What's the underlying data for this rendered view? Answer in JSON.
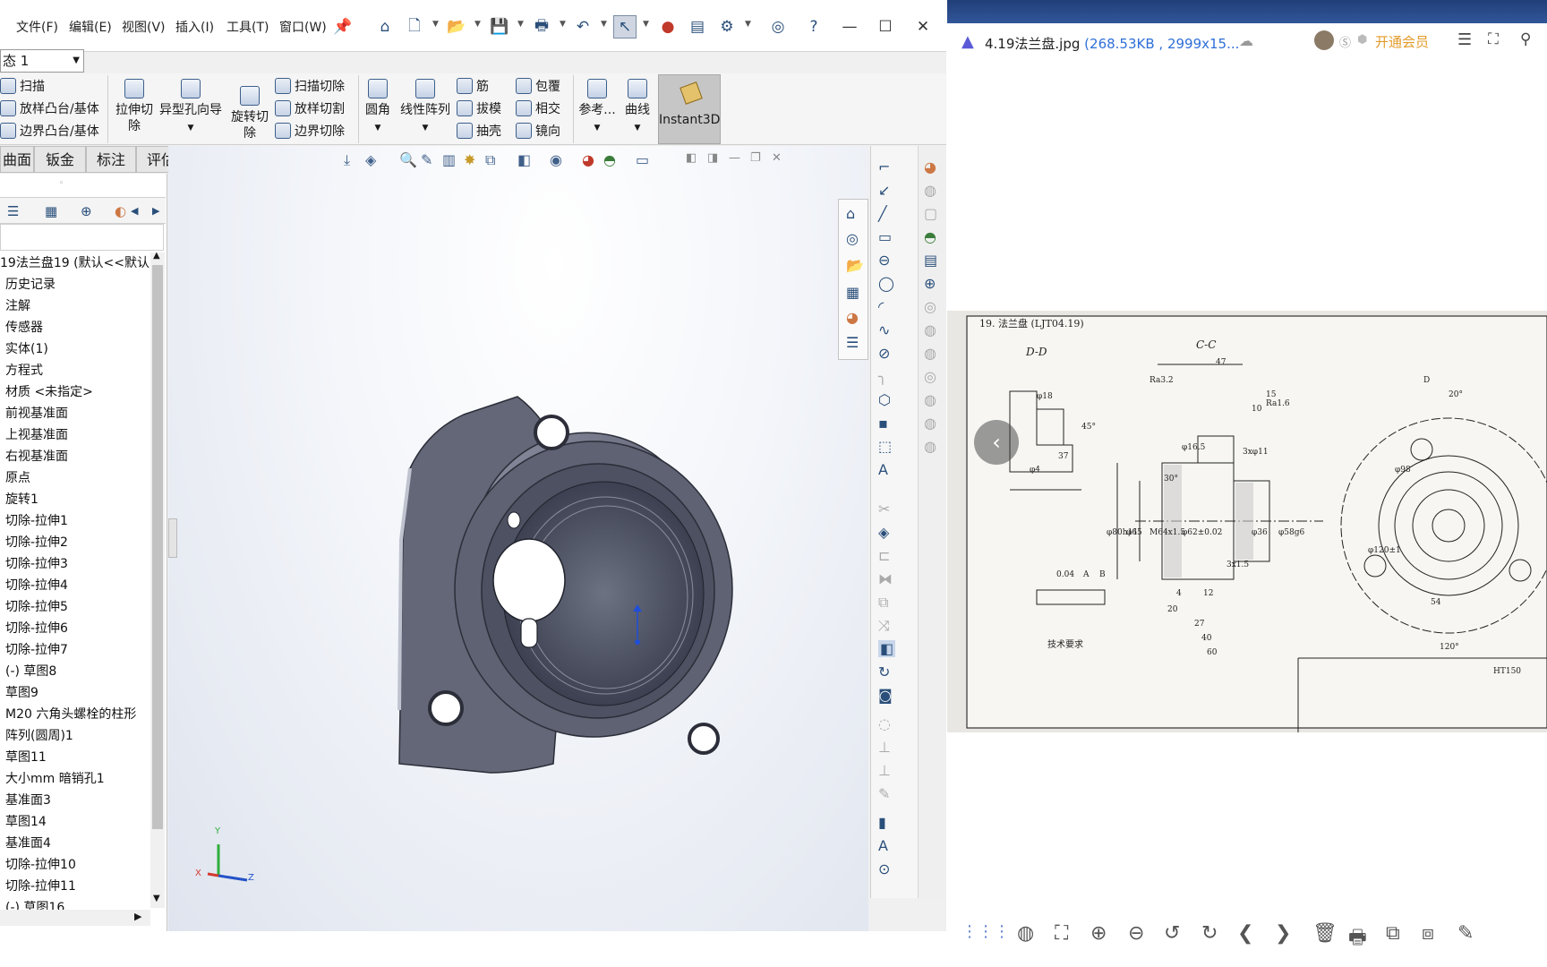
{
  "menu": {
    "items": [
      "文件(F)",
      "编辑(E)",
      "视图(V)",
      "插入(I)",
      "工具(T)",
      "窗口(W)"
    ],
    "config_value": "态 1"
  },
  "ribbon": {
    "small": {
      "sweep": "扫描",
      "loft_boss": "放样凸台/基体",
      "boundary_boss": "边界凸台/基体",
      "sweep_cut": "扫描切除",
      "loft_cut": "放样切割",
      "boundary_cut": "边界切除",
      "rib": "筋",
      "draft": "拔模",
      "shell": "抽壳",
      "wrap": "包覆",
      "intersect": "相交",
      "mirror": "镜向"
    },
    "big": {
      "extrude_cut_1": "拉伸切",
      "extrude_cut_2": "除",
      "hole_wizard": "异型孔向导",
      "revolve_cut_1": "旋转切",
      "revolve_cut_2": "除",
      "fillet": "圆角",
      "linear_pattern": "线性阵列",
      "reference": "参考...",
      "curves": "曲线",
      "instant3d": "Instant3D"
    }
  },
  "tabs": [
    "曲面",
    "钣金",
    "标注",
    "评估"
  ],
  "tree": {
    "items": [
      "19法兰盘19 (默认<<默认",
      "历史记录",
      "注解",
      "传感器",
      "实体(1)",
      "方程式",
      "材质 <未指定>",
      "前视基准面",
      "上视基准面",
      "右视基准面",
      "原点",
      "旋转1",
      "切除-拉伸1",
      "切除-拉伸2",
      "切除-拉伸3",
      "切除-拉伸4",
      "切除-拉伸5",
      "切除-拉伸6",
      "切除-拉伸7",
      "(-) 草图8",
      "草图9",
      "M20 六角头螺栓的柱形",
      "阵列(圆周)1",
      "草图11",
      "大小mm 暗销孔1",
      "基准面3",
      "草图14",
      "基准面4",
      "切除-拉伸10",
      "切除-拉伸11",
      "(-) 草图16"
    ]
  },
  "triad": {
    "x": "X",
    "y": "Y",
    "z": "Z"
  },
  "viewer": {
    "filename": "4.19法兰盘.jpg",
    "meta": "(268.53KB , 2999x15...",
    "vip": "开通会员"
  },
  "drawing": {
    "title": "19. 法兰盘 (LJT04.19)",
    "view_dd": "D-D",
    "view_cc": "C-C",
    "dims": [
      "47",
      "15",
      "10",
      "Ra3.2",
      "Ra1.6",
      "45°",
      "37",
      "φ18",
      "φ4",
      "φ80h11",
      "φ65",
      "M64x1.5",
      "φ62±0.02",
      "φ36",
      "φ58g6",
      "φ16.5",
      "30°",
      "0.04",
      "A",
      "B",
      "3x1.5",
      "4",
      "12",
      "20",
      "27",
      "40",
      "60",
      "φ98",
      "φ120±1",
      "54",
      "20°",
      "120°",
      "D",
      "HT150",
      "3xφ11"
    ],
    "tech_req": "技术要求"
  },
  "colors": {
    "model": "#5f6475",
    "viewer_meta": "#2e6fd8",
    "vip": "#e39b2b"
  }
}
